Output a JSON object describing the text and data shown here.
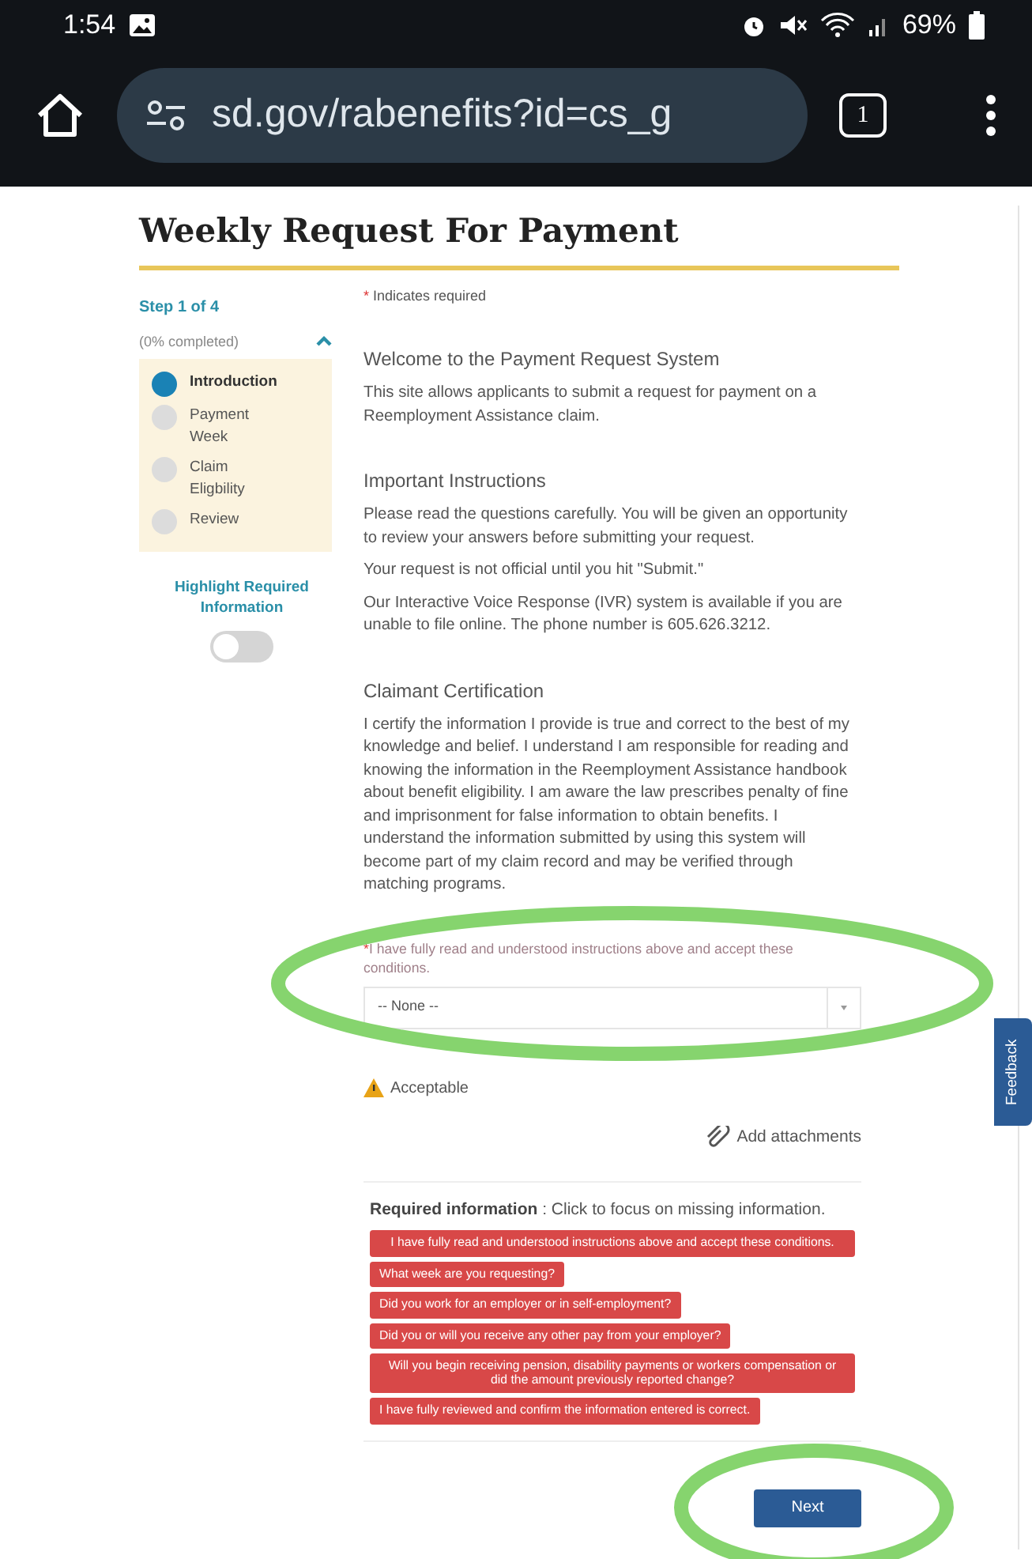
{
  "status_bar": {
    "time": "1:54",
    "battery": "69%"
  },
  "browser": {
    "url": "sd.gov/rabenefits?id=cs_g",
    "tab_count": "1"
  },
  "page": {
    "title": "Weekly Request For Payment"
  },
  "sidebar": {
    "step": "Step 1 of 4",
    "progress": "(0% completed)",
    "expanded": true,
    "steps": [
      {
        "label": "Introduction",
        "selected": true
      },
      {
        "label": "Payment Week",
        "selected": false
      },
      {
        "label": "Claim Eligbility",
        "selected": false
      },
      {
        "label": "Review",
        "selected": false
      }
    ],
    "highlight_label": "Highlight Required Information",
    "highlight_toggle": {
      "on": false
    }
  },
  "form": {
    "required_mark": "*",
    "required_note": "Indicates required",
    "sections": [
      {
        "heading": "Welcome to the Payment Request System",
        "paragraphs": [
          "This site allows applicants to submit a request for payment on a Reemployment Assistance claim."
        ]
      },
      {
        "heading": "Important Instructions",
        "paragraphs": [
          "Please read the questions carefully. You will be given an opportunity to review your answers before submitting your request.",
          "Your request is not official until you hit \"Submit.\"",
          "Our Interactive Voice Response (IVR) system is available if you are unable to file online. The phone number is 605.626.3212."
        ]
      },
      {
        "heading": "Claimant Certification",
        "paragraphs": [
          "I certify the information I provide is true and correct to the best of my knowledge and belief. I understand I am responsible for reading and knowing the information in the Reemployment Assistance handbook about benefit eligibility. I am aware the law prescribes penalty of fine and imprisonment for false information to obtain benefits. I understand the information submitted by using this system will become part of my claim record and may be verified through matching programs."
        ]
      }
    ],
    "question": {
      "required": true,
      "label": "I have fully read and understood instructions above and accept these conditions.",
      "value": "-- None --"
    },
    "warning": "Acceptable",
    "attachments": "Add attachments",
    "required_info": {
      "title": "Required information",
      "hint": " : Click to focus on missing information.",
      "items": [
        "I have fully read and understood instructions above and accept these conditions.",
        "What week are you requesting?",
        "Did you work for an employer or in self-employment?",
        "Did you or will you receive any other pay from your employer?",
        "Will you begin receiving pension, disability payments or workers compensation or did the amount previously reported change?",
        "I have fully reviewed and confirm the information entered is correct."
      ]
    },
    "next": "Next"
  },
  "feedback": "Feedback"
}
